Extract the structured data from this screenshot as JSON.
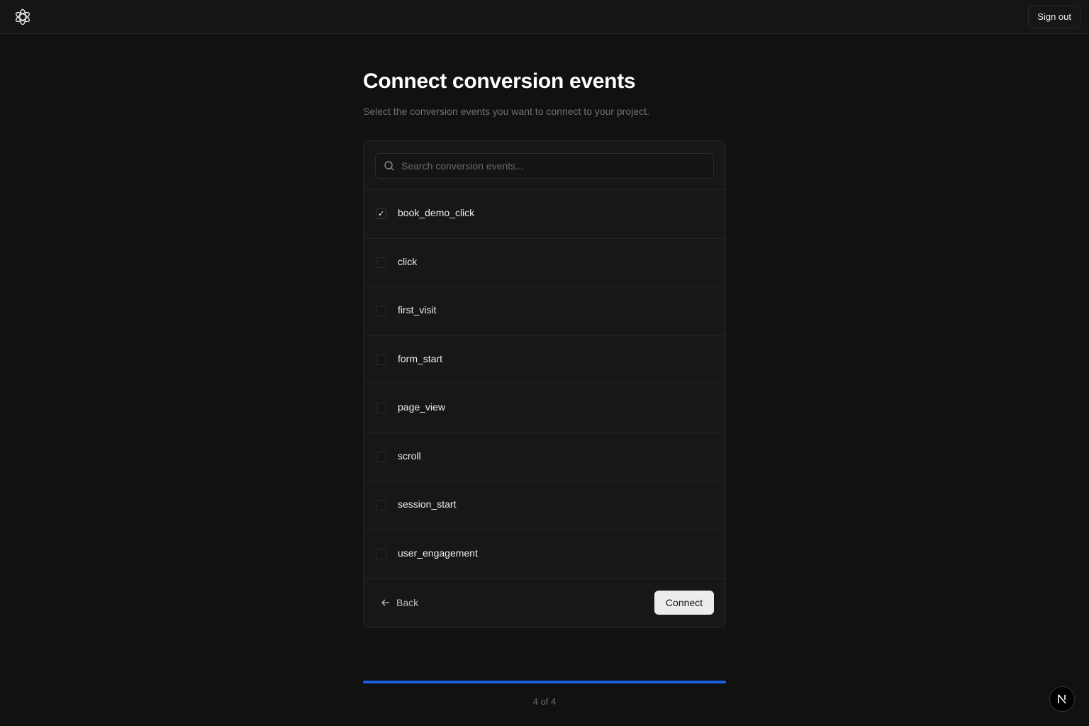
{
  "header": {
    "logo_icon": "openai-flower-icon",
    "sign_out_label": "Sign out"
  },
  "page": {
    "title": "Connect conversion events",
    "subtitle": "Select the conversion events you want to connect to your project."
  },
  "search": {
    "placeholder": "Search conversion events...",
    "value": ""
  },
  "events": [
    {
      "label": "book_demo_click",
      "checked": true
    },
    {
      "label": "click",
      "checked": false
    },
    {
      "label": "first_visit",
      "checked": false
    },
    {
      "label": "form_start",
      "checked": false
    },
    {
      "label": "page_view",
      "checked": false
    },
    {
      "label": "scroll",
      "checked": false
    },
    {
      "label": "session_start",
      "checked": false
    },
    {
      "label": "user_engagement",
      "checked": false
    }
  ],
  "footer": {
    "back_label": "Back",
    "connect_label": "Connect"
  },
  "progress": {
    "current": 4,
    "total": 4,
    "fraction": 1.0,
    "text": "4 of 4",
    "color": "#1a5fe0"
  },
  "corner_badge": {
    "letter_icon": "n-letter-icon"
  }
}
